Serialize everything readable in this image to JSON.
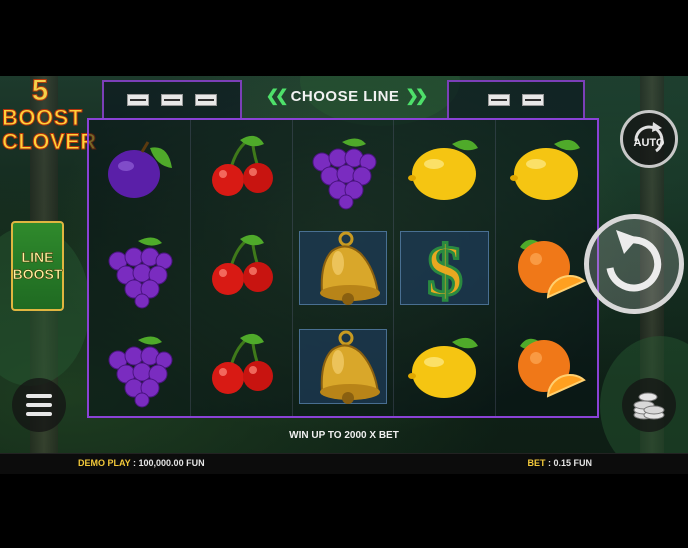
{
  "logo": {
    "number": "5",
    "line1": "BOOST",
    "line2": "CLOVER"
  },
  "line_boost": {
    "line1": "LINE",
    "line2": "BOOST"
  },
  "choose_line": {
    "label": "CHOOSE LINE",
    "left_arrows": "❮❮",
    "right_arrows": "❯❯"
  },
  "line_tabs": {
    "left": [
      "line-1",
      "line-2",
      "line-3"
    ],
    "right": [
      "line-4",
      "line-5"
    ]
  },
  "reels": [
    [
      "plum",
      "cherry",
      "grapes",
      "lemon",
      "lemon"
    ],
    [
      "grapes",
      "cherry",
      "bell",
      "dollar",
      "orange"
    ],
    [
      "grapes",
      "cherry",
      "bell",
      "lemon",
      "orange"
    ]
  ],
  "highlighted": [
    [
      1,
      2
    ],
    [
      1,
      3
    ],
    [
      2,
      2
    ]
  ],
  "buttons": {
    "auto_label": "AUTO"
  },
  "win_up": "WIN UP TO 2000 X BET",
  "demo_play": {
    "label": "DEMO PLAY",
    "value": ": 100,000.00 FUN"
  },
  "bet": {
    "label": "BET",
    "value": ": 0.15 FUN"
  },
  "colors": {
    "frame": "#8a42d6",
    "accent": "#f3c93a",
    "green": "#4ee06a"
  }
}
